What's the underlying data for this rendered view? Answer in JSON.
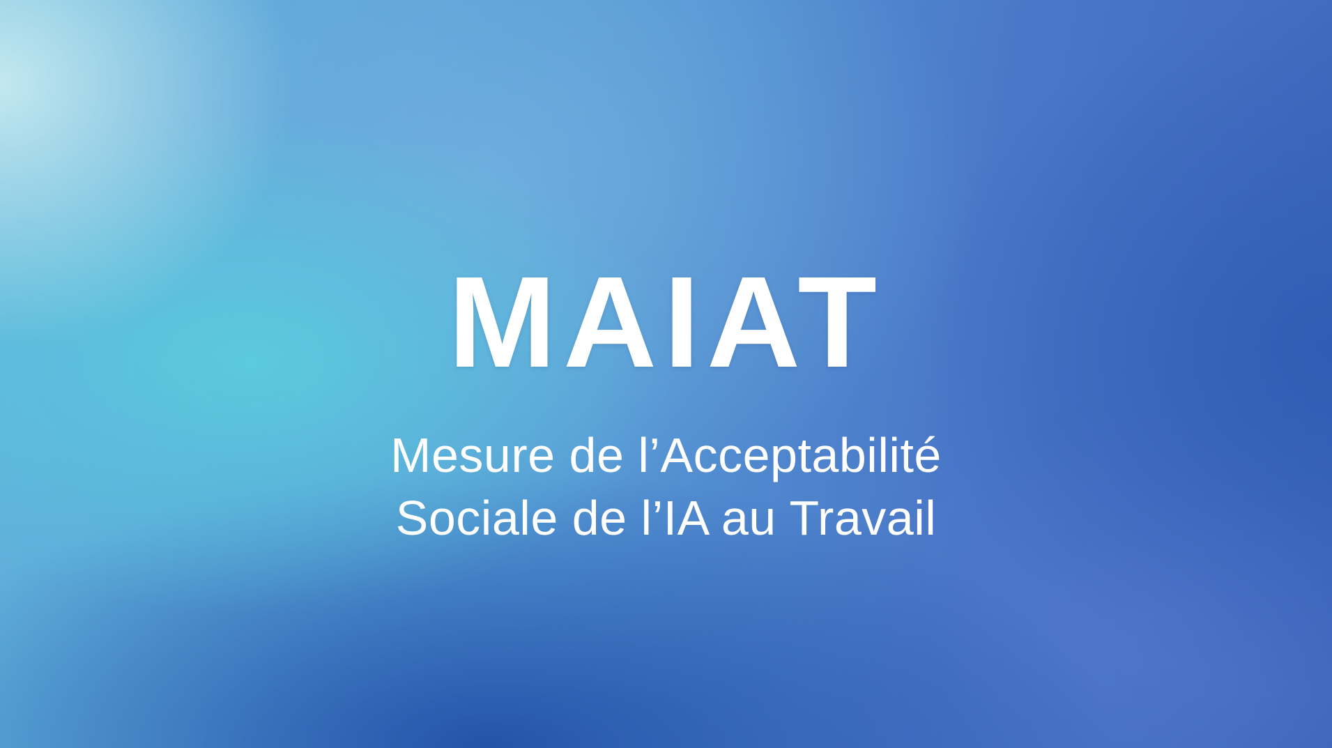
{
  "title": "MAIAT",
  "subtitle": {
    "line1": "Mesure de l’Acceptabilité",
    "line2": "Sociale de l’IA au Travail"
  },
  "colors": {
    "text": "#ffffff",
    "background_light": "#a8dbe8",
    "background_cyan": "#5ec5dc",
    "background_blue": "#3f66bb",
    "background_dark": "#2a55a8"
  }
}
